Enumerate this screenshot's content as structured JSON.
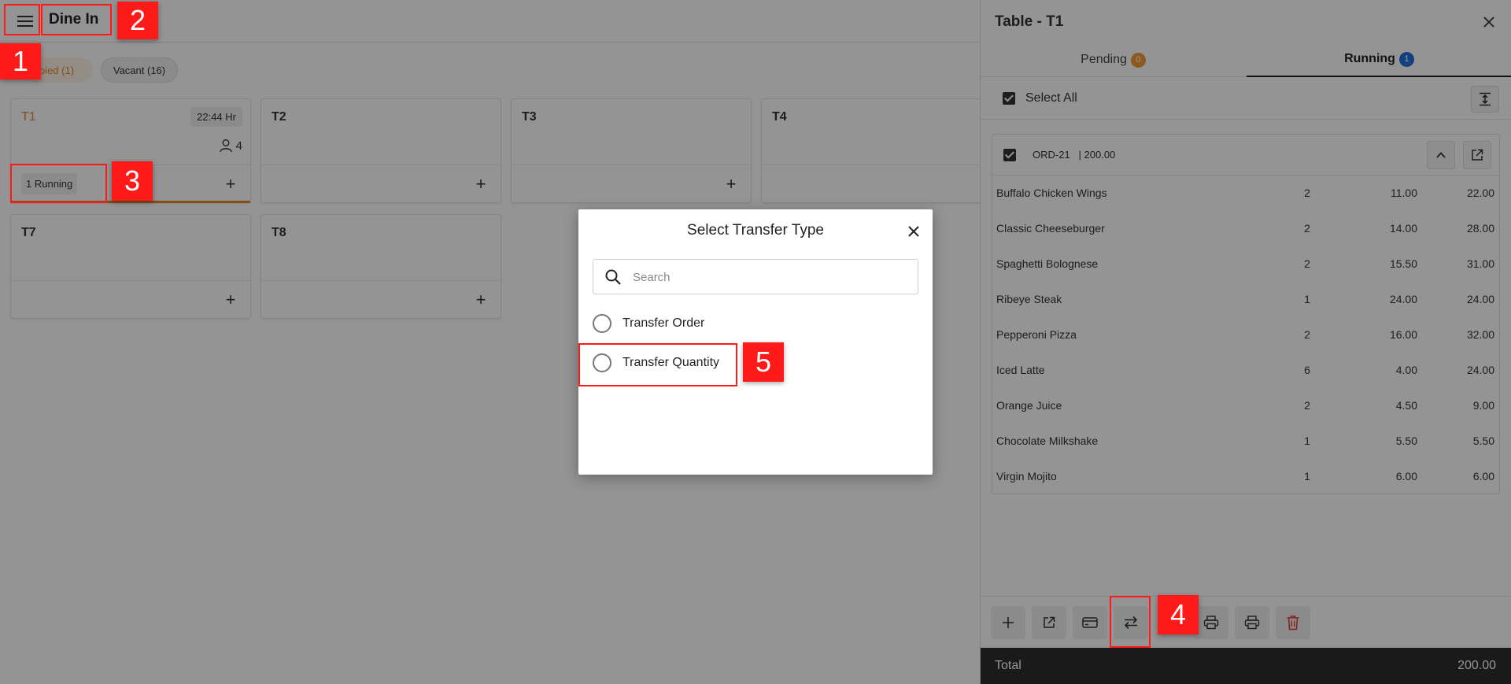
{
  "header": {
    "page_title": "Dine In"
  },
  "filters": {
    "occupied_label": "Occupied (1)",
    "occupied_visible": "pied (1)",
    "vacant_label": "Vacant (16)"
  },
  "tables": [
    {
      "name": "T1",
      "time": "22:44 Hr",
      "guests": "4",
      "running": "1 Running",
      "occupied": true
    },
    {
      "name": "T2"
    },
    {
      "name": "T3"
    },
    {
      "name": "T4"
    },
    {
      "name": "T7"
    },
    {
      "name": "T8"
    }
  ],
  "panel": {
    "title": "Table - T1",
    "tabs": [
      {
        "label": "Pending",
        "count": "0"
      },
      {
        "label": "Running",
        "count": "1"
      }
    ],
    "select_all_label": "Select All",
    "order": {
      "id_label": "ORD-21",
      "amount_label": "| 200.00",
      "items": [
        {
          "name": "Buffalo Chicken Wings",
          "qty": "2",
          "price": "11.00",
          "total": "22.00"
        },
        {
          "name": "Classic Cheeseburger",
          "qty": "2",
          "price": "14.00",
          "total": "28.00"
        },
        {
          "name": "Spaghetti Bolognese",
          "qty": "2",
          "price": "15.50",
          "total": "31.00"
        },
        {
          "name": "Ribeye Steak",
          "qty": "1",
          "price": "24.00",
          "total": "24.00"
        },
        {
          "name": "Pepperoni Pizza",
          "qty": "2",
          "price": "16.00",
          "total": "32.00"
        },
        {
          "name": "Iced Latte",
          "qty": "6",
          "price": "4.00",
          "total": "24.00"
        },
        {
          "name": "Orange Juice",
          "qty": "2",
          "price": "4.50",
          "total": "9.00"
        },
        {
          "name": "Chocolate Milkshake",
          "qty": "1",
          "price": "5.50",
          "total": "5.50"
        },
        {
          "name": "Virgin Mojito",
          "qty": "1",
          "price": "6.00",
          "total": "6.00"
        }
      ]
    },
    "total_label": "Total",
    "total_value": "200.00"
  },
  "modal": {
    "title": "Select Transfer Type",
    "search_placeholder": "Search",
    "options": [
      "Transfer Order",
      "Transfer Quantity"
    ]
  },
  "markers": [
    "1",
    "2",
    "3",
    "4",
    "5"
  ],
  "colors": {
    "accent_orange": "#e8832a",
    "accent_blue": "#2170d8",
    "marker_red": "#ff1a1a"
  }
}
